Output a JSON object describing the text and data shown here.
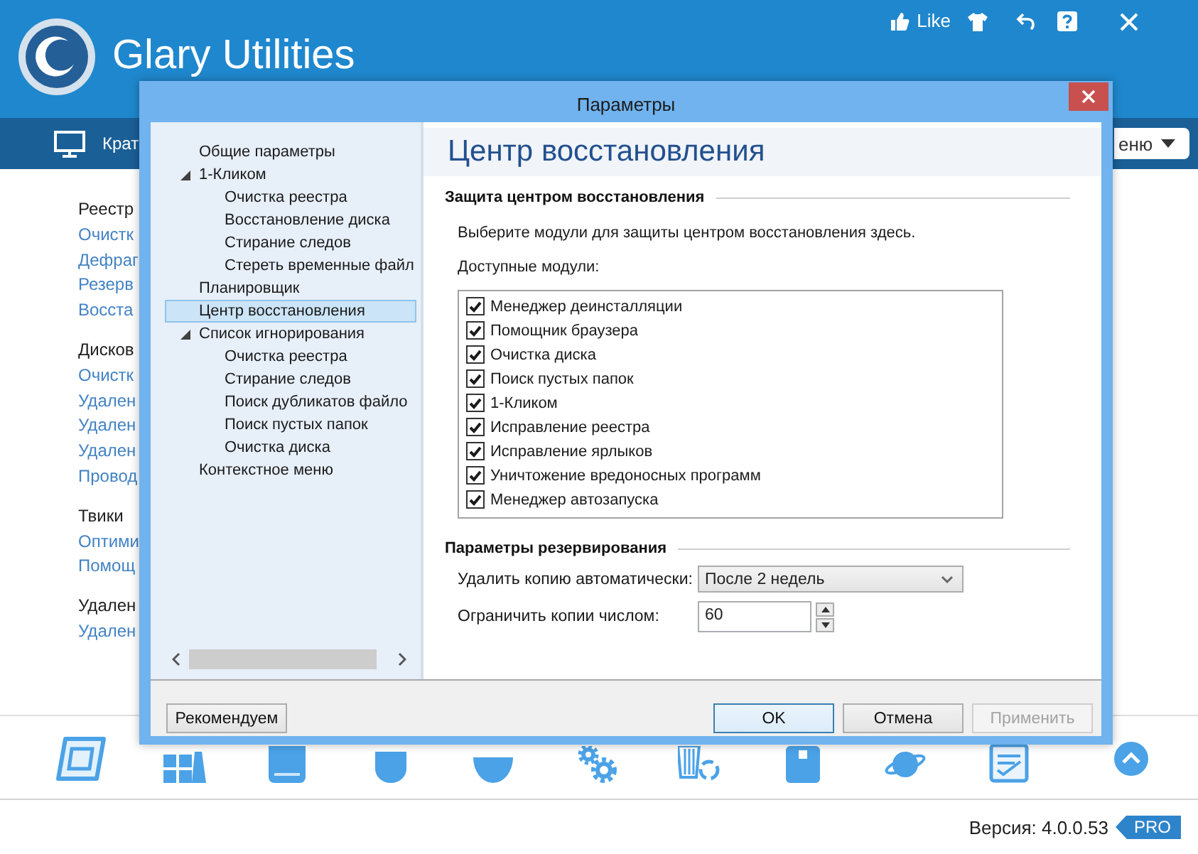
{
  "app": {
    "title": "Glary Utilities",
    "like_label": "Like",
    "nav_label": "Крат",
    "menu_label": "еню"
  },
  "sections": [
    {
      "heading": "Реестр",
      "links": [
        "Очистк",
        "Дефраг",
        "Резерв",
        "Восста"
      ]
    },
    {
      "heading": "Дисков",
      "links": [
        "Очистк",
        "Удален",
        "Удален",
        "Удален",
        "Провод"
      ]
    },
    {
      "heading": "Твики",
      "links": [
        "Оптими",
        "Помощ"
      ]
    },
    {
      "heading": "Удален",
      "links": [
        "Удален"
      ]
    }
  ],
  "dialog": {
    "title": "Параметры",
    "tree": [
      {
        "label": "Общие параметры",
        "selected": false
      },
      {
        "label": "1-Кликом",
        "selected": false,
        "expanded": true,
        "children": [
          {
            "label": "Очистка реестра",
            "selected": false
          },
          {
            "label": "Восстановление диска",
            "selected": false
          },
          {
            "label": "Стирание следов",
            "selected": false
          },
          {
            "label": "Стереть временные файл",
            "selected": false
          }
        ]
      },
      {
        "label": "Планировщик",
        "selected": false
      },
      {
        "label": "Центр восстановления",
        "selected": true
      },
      {
        "label": "Список игнорирования",
        "selected": false,
        "expanded": true,
        "children": [
          {
            "label": "Очистка реестра",
            "selected": false
          },
          {
            "label": "Стирание следов",
            "selected": false
          },
          {
            "label": "Поиск дубликатов файло",
            "selected": false
          },
          {
            "label": "Поиск пустых папок",
            "selected": false
          },
          {
            "label": "Очистка диска",
            "selected": false
          }
        ]
      },
      {
        "label": "Контекстное меню",
        "selected": false
      }
    ],
    "page_title": "Центр восстановления",
    "protection": {
      "heading": "Защита центром восстановления",
      "description": "Выберите модули для защиты центром восстановления здесь.",
      "modules_label": "Доступные модули:",
      "modules": [
        {
          "label": "Менеджер деинсталляции",
          "checked": true
        },
        {
          "label": "Помощник браузера",
          "checked": true
        },
        {
          "label": "Очистка диска",
          "checked": true
        },
        {
          "label": "Поиск пустых папок",
          "checked": true
        },
        {
          "label": "1-Кликом",
          "checked": true
        },
        {
          "label": "Исправление реестра",
          "checked": true
        },
        {
          "label": "Исправление ярлыков",
          "checked": true
        },
        {
          "label": "Уничтожение вредоносных программ",
          "checked": true
        },
        {
          "label": "Менеджер автозапуска",
          "checked": true
        }
      ]
    },
    "backup": {
      "heading": "Параметры резервирования",
      "fields": [
        {
          "kind": "select",
          "label": "Удалить копию автоматически:",
          "value": "После 2 недель"
        },
        {
          "kind": "spinner",
          "label": "Ограничить копии числом:",
          "value": "60"
        }
      ]
    },
    "footer": {
      "left_buttons": [
        {
          "label": "Рекомендуем",
          "focused": false,
          "disabled": false
        }
      ],
      "right_buttons": [
        {
          "label": "OK",
          "focused": true,
          "disabled": false
        },
        {
          "label": "Отмена",
          "focused": false,
          "disabled": false
        },
        {
          "label": "Применить",
          "focused": false,
          "disabled": true
        }
      ]
    }
  },
  "version": "Версия: 4.0.0.53",
  "edition": "PRO"
}
